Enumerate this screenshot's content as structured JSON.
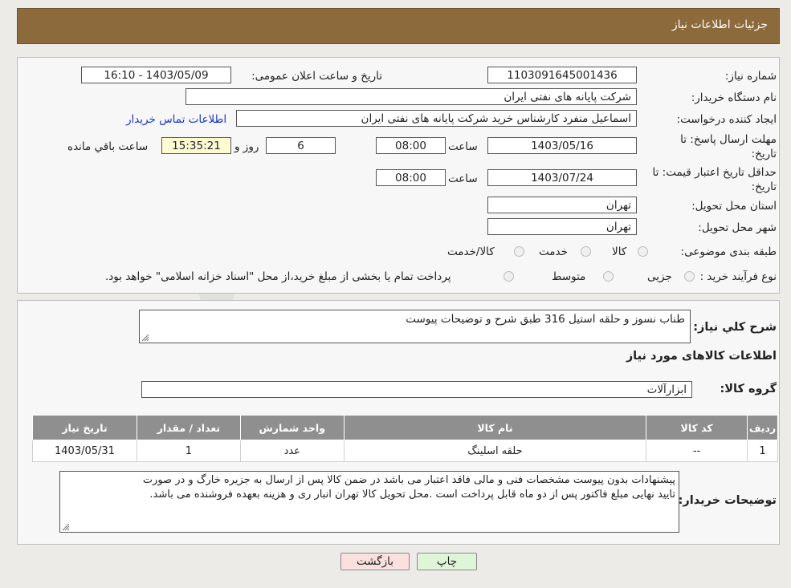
{
  "header": {
    "title": "جزئیات اطلاعات نیاز"
  },
  "fields": {
    "need_number_label": "شماره نیاز:",
    "need_number": "1103091645001436",
    "announce_label": "تاریخ و ساعت اعلان عمومی:",
    "announce_value": "1403/05/09 - 16:10",
    "buyer_org_label": "نام دستگاه خریدار:",
    "buyer_org": "شرکت پایانه های نفتی ایران",
    "creator_label": "ایجاد کننده درخواست:",
    "creator": "اسماعیل  منفرد کارشناس خرید شرکت پایانه های نفتی ایران",
    "contact_link": "اطلاعات تماس خریدار",
    "deadline_label_1": "مهلت ارسال پاسخ: تا",
    "deadline_label_2": "تاریخ:",
    "deadline_date": "1403/05/16",
    "time_label": "ساعت",
    "deadline_time": "08:00",
    "days_value": "6",
    "days_label": "روز و",
    "remaining_time": "15:35:21",
    "remaining_label": "ساعت باقي مانده",
    "validity_label_1": "حداقل تاریخ اعتبار قیمت: تا",
    "validity_label_2": "تاریخ:",
    "validity_date": "1403/07/24",
    "validity_time": "08:00",
    "province_label": "استان محل تحویل:",
    "province": "تهران",
    "city_label": "شهر محل تحویل:",
    "city": "تهران",
    "category_label": "طبقه بندی موضوعی:",
    "category_options": [
      "کالا",
      "خدمت",
      "کالا/خدمت"
    ],
    "process_label": "نوع فرآیند خرید :",
    "process_options": [
      "جزیی",
      "متوسط"
    ],
    "process_note": "پرداخت تمام یا بخشی از مبلغ خرید،از محل \"اسناد خزانه اسلامی\" خواهد بود."
  },
  "summary": {
    "label": "شرح کلي نياز:",
    "value": "طناب نسوز و حلقه استیل 316 طبق شرح و توضیحات پیوست"
  },
  "goods_section": {
    "title": "اطلاعات کالاهای مورد نیاز",
    "group_label": "گروه کالا:",
    "group_value": "ابزارآلات"
  },
  "table": {
    "headers": [
      "ردیف",
      "کد کالا",
      "نام کالا",
      "واحد شمارش",
      "تعداد / مقدار",
      "تاریخ نیاز"
    ],
    "rows": [
      [
        "1",
        "--",
        "حلقه اسلینگ",
        "عدد",
        "1",
        "1403/05/31"
      ]
    ]
  },
  "buyer_notes": {
    "label": "توضیحات خریدار:",
    "line1": "پیشنهادات بدون پیوست مشخصات فنی و مالی فاقد اعتبار می باشد در ضمن کالا پس از ارسال به جزیره خارگ و در صورت",
    "line2": "تایید نهایی مبلغ فاکتور پس از دو ماه قابل پرداخت است .محل تحویل کالا تهران انبار ری و هزینه بعهده فروشنده می باشد."
  },
  "buttons": {
    "print": "چاپ",
    "back": "بازگشت"
  },
  "colors": {
    "header": "#8c6a3b",
    "back_button": "#fbe0e0",
    "print_button": "#dff5d8",
    "link": "#1a36c9"
  }
}
